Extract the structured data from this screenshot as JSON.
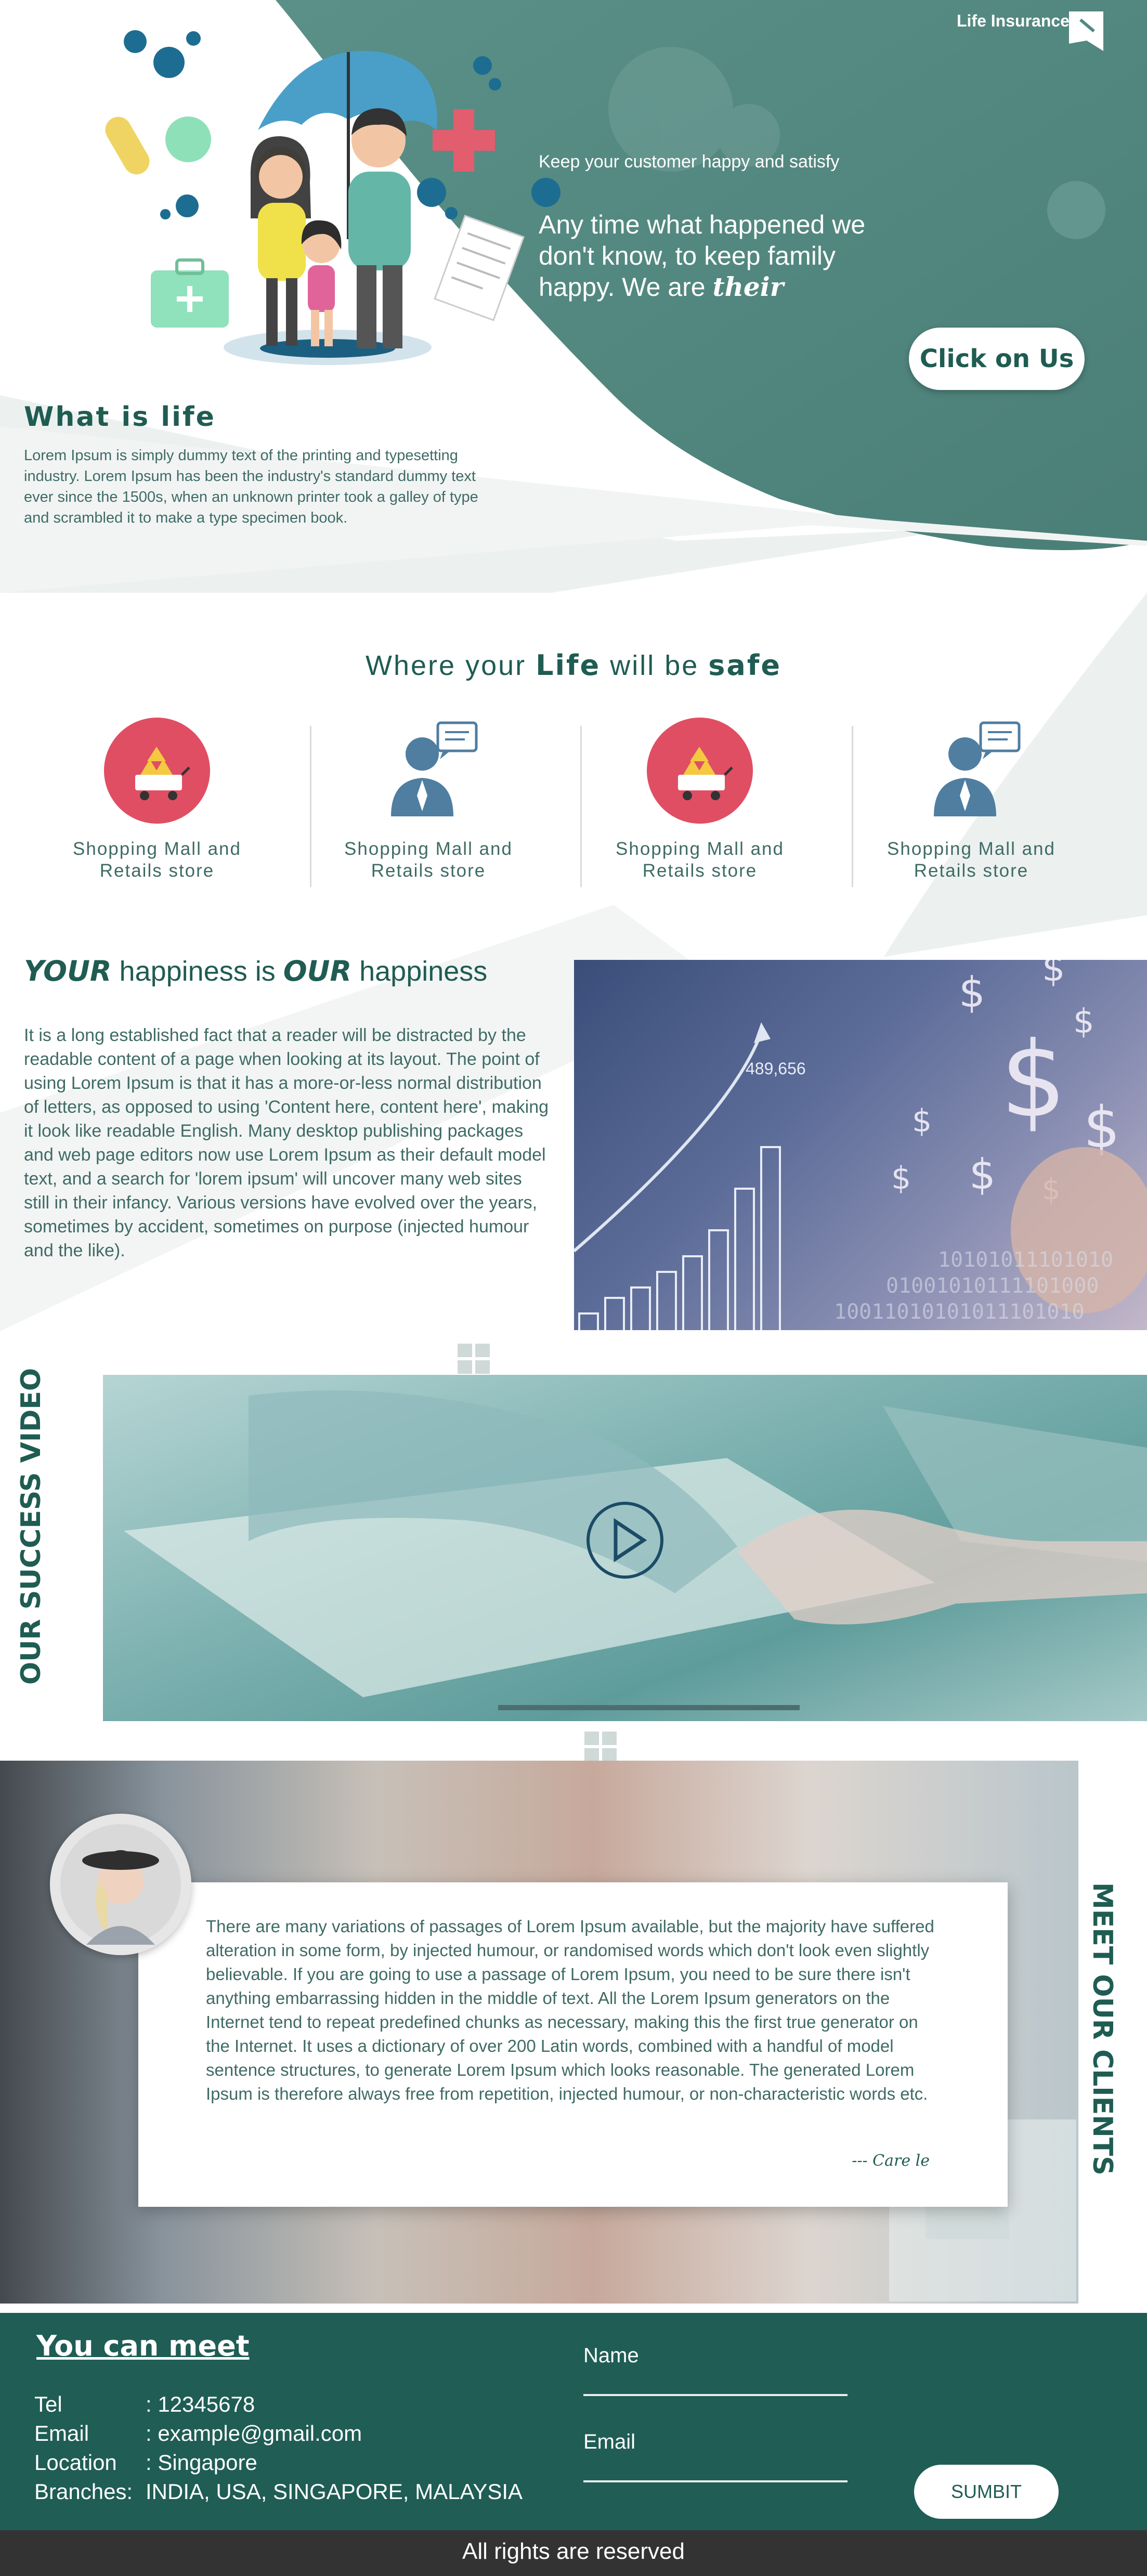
{
  "hero": {
    "brand": "Life Insurance",
    "tagline": "Keep your customer happy and satisfy",
    "headline_main": "Any time what happened we don't know, to keep family happy. We are",
    "headline_emph": "their",
    "cta": "Click on Us"
  },
  "what_is_life": {
    "title": "What is life",
    "body": "Lorem Ipsum is simply dummy text of the printing and typesetting industry. Lorem Ipsum has been the industry's standard dummy text ever since the 1500s, when an unknown printer took a galley of type and scrambled it to make a type specimen book."
  },
  "safe": {
    "pre": "Where your",
    "life": "Life",
    "mid": "will be",
    "safe": "safe",
    "features": [
      {
        "icon": "gold-cart-icon",
        "line1": "Shopping Mall and",
        "line2": "Retails store"
      },
      {
        "icon": "businessman-chat-icon",
        "line1": "Shopping Mall and",
        "line2": "Retails store"
      },
      {
        "icon": "gold-cart-icon",
        "line1": "Shopping Mall and",
        "line2": "Retails store"
      },
      {
        "icon": "businessman-chat-icon",
        "line1": "Shopping Mall and",
        "line2": "Retails store"
      }
    ]
  },
  "happiness": {
    "your": "YOUR",
    "mid": "happiness is",
    "our": "OUR",
    "end": "happiness",
    "body": "It is a long established fact that a reader will be distracted by the readable content of a page when looking at its layout. The point of using Lorem Ipsum is that it has a more-or-less normal distribution of letters, as opposed to using 'Content here, content here', making it look like readable English. Many desktop publishing packages and web page editors now use Lorem Ipsum as their default model text, and a search for 'lorem ipsum' will uncover many web sites still in their infancy. Various versions have evolved over the years, sometimes by accident, sometimes on purpose (injected humour and the like).",
    "photo_number": "489,656",
    "photo_binary1": "10101011101010",
    "photo_binary2": "01001010111101000",
    "photo_binary3": "10011010101011101010"
  },
  "video": {
    "label": "OUR SUCCESS VIDEO"
  },
  "clients": {
    "label": "MEET OUR CLIENTS",
    "quote": "There are many variations of passages of Lorem Ipsum available, but the majority have suffered alteration in some form, by injected humour, or randomised words which don't look even slightly believable. If you are going to use a passage of Lorem Ipsum, you need to be sure there isn't anything embarrassing hidden in the middle of text. All the Lorem Ipsum generators on the Internet tend to repeat predefined chunks as necessary, making this the first true generator on the Internet. It uses a dictionary of over 200 Latin words, combined with a handful of model sentence structures, to generate Lorem Ipsum which looks reasonable. The generated Lorem Ipsum is therefore always free from repetition, injected humour, or non-characteristic words etc.",
    "signature": "--- Care le"
  },
  "footer": {
    "title": "You can meet",
    "contacts": [
      {
        "key": "Tel",
        "value": ": 12345678"
      },
      {
        "key": "Email",
        "value": ": example@gmail.com"
      },
      {
        "key": "Location",
        "value": ": Singapore"
      },
      {
        "key": "Branches:",
        "value": "INDIA, USA, SINGAPORE, MALAYSIA"
      }
    ],
    "name_label": "Name",
    "email_label": "Email",
    "submit": "SUMBIT",
    "copyright": "All rights are reserved"
  },
  "colors": {
    "teal_dark": "#1f5c52",
    "teal_main": "#4f8980",
    "accent_red": "#e04e63",
    "footer": "#1f5d55"
  }
}
